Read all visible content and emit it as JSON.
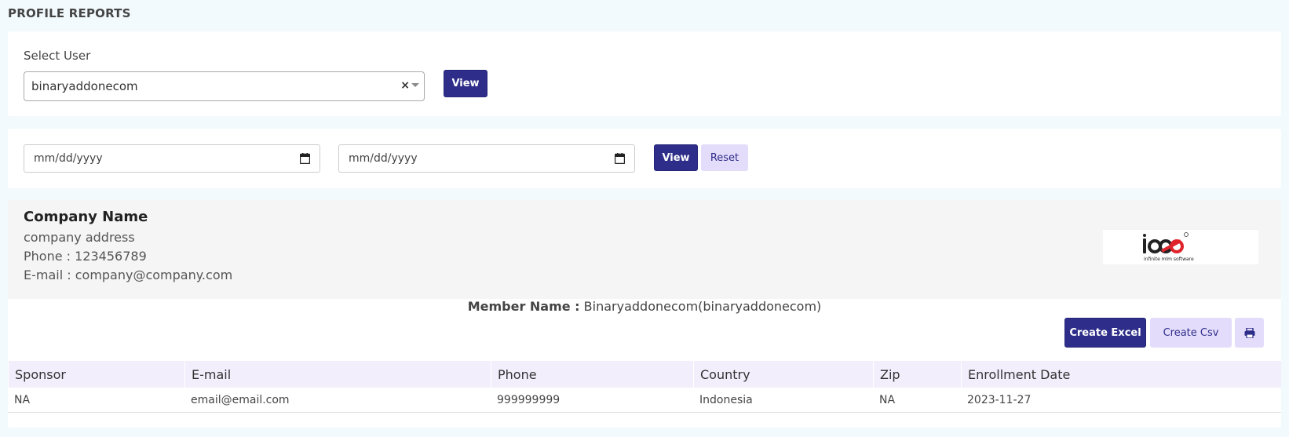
{
  "page": {
    "title": "PROFILE REPORTS"
  },
  "user_filter": {
    "label": "Select User",
    "selected_user": "binaryaddonecom",
    "clear_symbol": "×",
    "view_label": "View"
  },
  "date_filter": {
    "from_placeholder": "mm/dd/yyyy",
    "to_placeholder": "mm/dd/yyyy",
    "view_label": "View",
    "reset_label": "Reset"
  },
  "company": {
    "name": "Company Name",
    "address": "company address",
    "phone": "Phone : 123456789",
    "email": "E-mail : company@company.com",
    "logo_text": "infinite mlm software"
  },
  "member": {
    "label": "Member Name :",
    "value": "Binaryaddonecom(binaryaddonecom)"
  },
  "export": {
    "excel_label": "Create Excel",
    "csv_label": "Create Csv",
    "print_icon": "print-icon"
  },
  "table": {
    "columns": [
      "Sponsor",
      "E-mail",
      "Phone",
      "Country",
      "Zip",
      "Enrollment Date"
    ],
    "rows": [
      [
        "NA",
        "email@email.com",
        "999999999",
        "Indonesia",
        "NA",
        "2023-11-27"
      ]
    ]
  },
  "colors": {
    "primary": "#2e2e8a",
    "secondary": "#e4dcfb",
    "background": "#f2fafd",
    "table_header": "#f2eefc",
    "logo_red": "#e0242b"
  }
}
